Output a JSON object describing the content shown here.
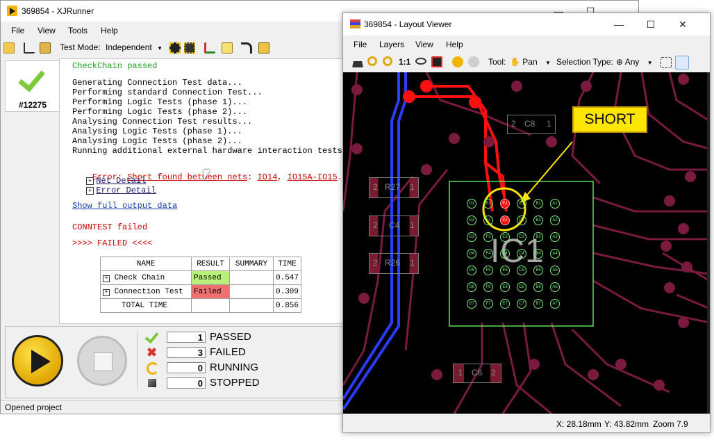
{
  "runner": {
    "title": "369854 - XJRunner",
    "menu": [
      "File",
      "View",
      "Tools",
      "Help"
    ],
    "test_mode_label": "Test Mode:",
    "test_mode_value": "Independent",
    "run_id": "#12275",
    "log": {
      "checkchain": "CheckChain passed",
      "lines": [
        "Generating Connection Test data...",
        "Performing standard Connection Test...",
        "Performing Logic Tests (phase 1)...",
        "Performing Logic Tests (phase 2)...",
        "Analysing Connection Test results...",
        "Analysing Logic Tests (phase 1)...",
        "Analysing Logic Tests (phase 2)...",
        "Running additional external hardware interaction tests"
      ],
      "error_prefix": "Error:",
      "error_link": "Short found between nets",
      "error_sep": ":",
      "net1": "IO14",
      "net2": "IO15A-IO15",
      "net_detail": "Net Detail",
      "error_detail": "Error Detail",
      "show_full": "Show full output data",
      "conntest": "CONNTEST failed",
      "failed_banner": ">>>> FAILED <<<<"
    },
    "results": {
      "headers": [
        "NAME",
        "RESULT",
        "SUMMARY",
        "TIME"
      ],
      "rows": [
        {
          "name": "Check Chain",
          "result": "Passed",
          "summary": "",
          "time": "0.547"
        },
        {
          "name": "Connection Test",
          "result": "Failed",
          "summary": "",
          "time": "0.309"
        }
      ],
      "total_label": "TOTAL TIME",
      "total_time": "0.856"
    },
    "counters": [
      {
        "value": "1",
        "label": "PASSED"
      },
      {
        "value": "3",
        "label": "FAILED"
      },
      {
        "value": "0",
        "label": "RUNNING"
      },
      {
        "value": "0",
        "label": "STOPPED"
      }
    ],
    "status": "Opened project",
    "colors": {
      "pass": "#21a021",
      "fail": "#d00000",
      "passed_cell": "#b8f07a",
      "failed_cell": "#f07070"
    }
  },
  "viewer": {
    "title": "369854 - Layout Viewer",
    "menu": [
      "File",
      "Layers",
      "View",
      "Help"
    ],
    "zoom_reset": "1:1",
    "tool_label": "Tool:",
    "tool_value": "Pan",
    "selection_label": "Selection Type:",
    "selection_value": "Any",
    "short_label": "SHORT",
    "components": {
      "ic": "IC1",
      "r27": "R27",
      "c4": "C4",
      "r26": "R26",
      "c8": "C8",
      "c6": "C6",
      "pin1": "1",
      "pin2": "2"
    },
    "pad_rows": [
      [
        "G1",
        "E1",
        "E1",
        "C1",
        "B1",
        "A1"
      ],
      [
        "G2",
        "F2",
        "E2",
        "C2",
        "B2",
        "A2"
      ],
      [
        "G3",
        "F3",
        "E3",
        "C3",
        "B3",
        "A3"
      ],
      [
        "G4",
        "F4",
        "E4",
        "C4",
        "B4",
        "A4"
      ],
      [
        "G5",
        "F5",
        "E5",
        "C5",
        "B5",
        "A5"
      ],
      [
        "G6",
        "F6",
        "E6",
        "C6",
        "B6",
        "A6"
      ],
      [
        "G7",
        "F7",
        "E7",
        "C7",
        "B7",
        "A7"
      ]
    ],
    "status": {
      "x": "X: 28.18mm",
      "y": "Y: 43.82mm",
      "zoom": "Zoom 7.9"
    },
    "colors": {
      "board": "#000000",
      "trace_red": "#ff1010",
      "trace_blue": "#2a3cff",
      "copper": "#8a1a44",
      "silk": "#7df07d",
      "short_box": "#ffe600"
    }
  }
}
